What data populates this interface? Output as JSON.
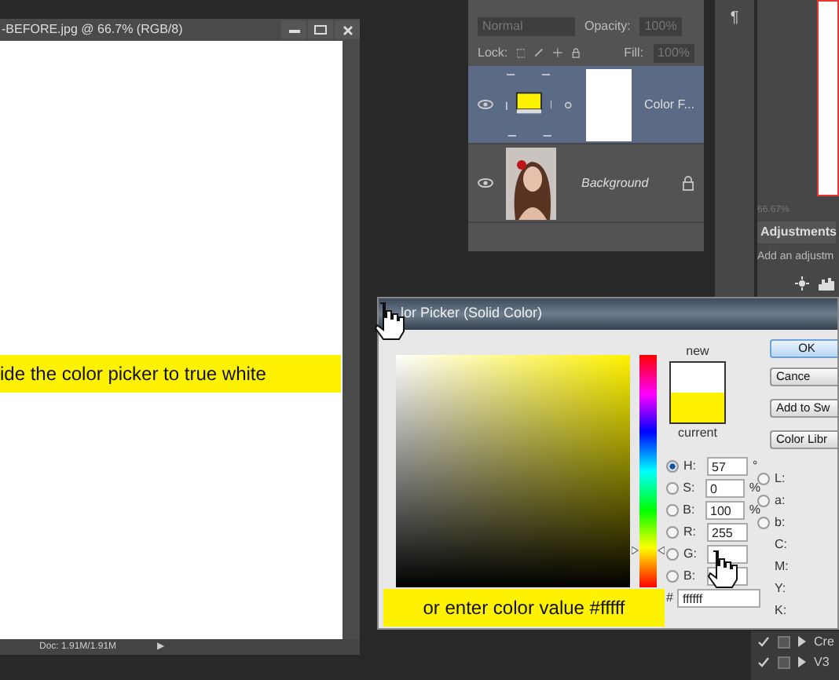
{
  "document_window": {
    "title": "-BEFORE.jpg @ 66.7% (RGB/8)",
    "status": "Doc: 1.91M/1.91M",
    "status_arrow": "▶"
  },
  "annotations": [
    {
      "text": "ide the color picker to true white"
    },
    {
      "text": "or enter color value #fffff"
    }
  ],
  "layers_panel": {
    "blend_mode": "Normal",
    "opacity_label": "Opacity:",
    "opacity": "100%",
    "lock_label": "Lock:",
    "fill_label": "Fill:",
    "fill": "100%",
    "layers": [
      {
        "kind": "fill",
        "name": "Color F...",
        "visible": true,
        "selected": true,
        "locked": false
      },
      {
        "kind": "picture",
        "name": "Background",
        "visible": true,
        "selected": false,
        "locked": true
      }
    ]
  },
  "side_panel": {
    "glyph": "¶",
    "zoom": "66.67%",
    "tab": "Adjustments",
    "hint": "Add an adjustm",
    "rows": [
      {
        "label": "Cre",
        "checked": true
      },
      {
        "label": "V3",
        "checked": true
      }
    ]
  },
  "color_picker": {
    "title": "lor Picker (Solid Color)",
    "hue_slider": {
      "level": 0.16
    },
    "swatches": [
      {
        "label": "new",
        "color": "#ffffff"
      },
      {
        "label": "current",
        "color": "#fff200"
      }
    ],
    "buttons": [
      {
        "label": "OK",
        "default": true
      },
      {
        "label": "Cance",
        "default": false
      },
      {
        "label": "Add to Sw",
        "default": false
      },
      {
        "label": "Color Libr",
        "default": false
      }
    ],
    "hsb_rgb": [
      {
        "label": "H:",
        "value": "57",
        "unit": "°",
        "selected": true
      },
      {
        "label": "S:",
        "value": "0",
        "unit": "%",
        "selected": false
      },
      {
        "label": "B:",
        "value": "100",
        "unit": "%",
        "selected": false
      },
      {
        "label": "R:",
        "value": "255",
        "selected": false
      },
      {
        "label": "G:",
        "selected": false
      },
      {
        "label": "B:",
        "selected": false
      }
    ],
    "lab": [
      {
        "label": "L:",
        "selected": false
      },
      {
        "label": "a:",
        "selected": false
      },
      {
        "label": "b:",
        "selected": false
      }
    ],
    "cmyk": [
      {
        "label": "C:"
      },
      {
        "label": "M:"
      },
      {
        "label": "Y:"
      },
      {
        "label": "K:"
      }
    ],
    "hex_label": "#",
    "hex": "ffffff"
  }
}
